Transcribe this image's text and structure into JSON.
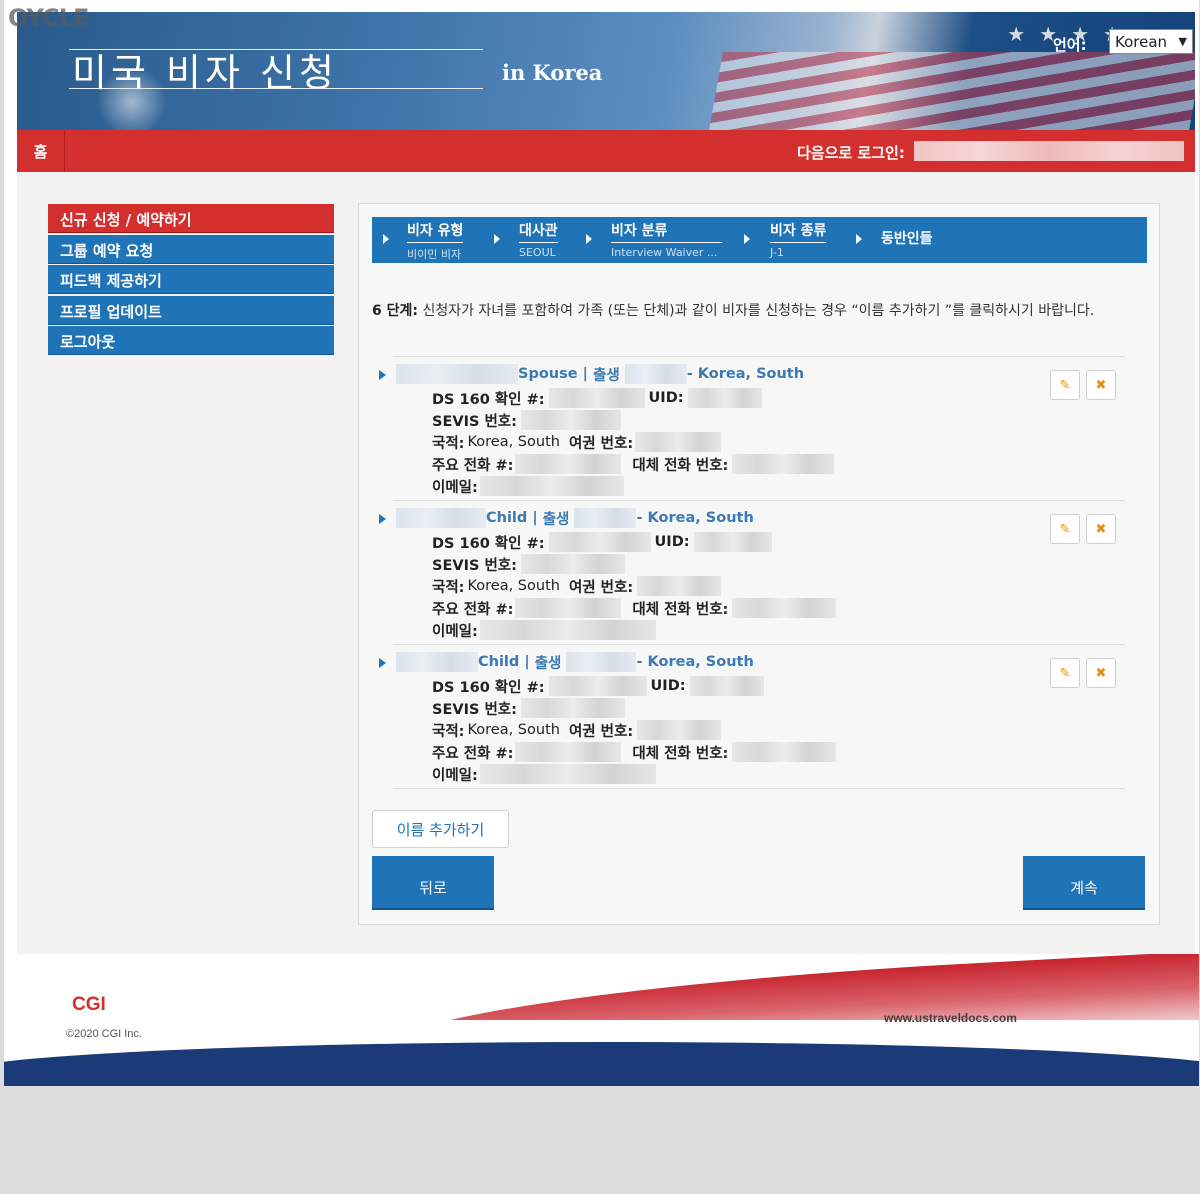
{
  "watermark": "OYCLE",
  "header": {
    "title": "미국 비자 신청",
    "subtitle": "in Korea",
    "language_label": "언어:",
    "language_value": "Korean"
  },
  "nav": {
    "home": "홈",
    "logged_in_label": "다음으로 로그인:"
  },
  "sidebar": {
    "items": [
      {
        "label": "신규 신청 / 예약하기",
        "active": true
      },
      {
        "label": "그룹 예약 요청",
        "active": false
      },
      {
        "label": "피드백 제공하기",
        "active": false
      },
      {
        "label": "프로필 업데이트",
        "active": false
      },
      {
        "label": "로그아웃",
        "active": false
      }
    ]
  },
  "steps": [
    {
      "title": "비자 유형",
      "value": "비이민 비자"
    },
    {
      "title": "대사관",
      "value": "SEOUL"
    },
    {
      "title": "비자 분류",
      "value": "Interview Waiver ..."
    },
    {
      "title": "비자 종류",
      "value": "J-1"
    },
    {
      "title": "동반인들",
      "value": ""
    }
  ],
  "instructions": {
    "step_label": "6 단계:",
    "text": "신청자가 자녀를 포함하여 가족 (또는 단체)과 같이 비자를 신청하는 경우 “이름 추가하기 ”를 클릭하시기 바랍니다."
  },
  "field_labels": {
    "ds160": "DS 160 확인 #:",
    "uid": "UID:",
    "sevis": "SEVIS 번호:",
    "nationality": "국적:",
    "passport": "여권 번호:",
    "primary_phone": "주요 전화 #:",
    "alt_phone": "대체 전화 번호:",
    "email": "이메일:"
  },
  "applicants": [
    {
      "relation": "Spouse |",
      "born_label": "출생",
      "country": "- Korea, South",
      "nationality": "Korea, South"
    },
    {
      "relation": "Child |",
      "born_label": "출생",
      "country": "- Korea, South",
      "nationality": "Korea, South"
    },
    {
      "relation": "Child |",
      "born_label": "출생",
      "country": "- Korea, South",
      "nationality": "Korea, South"
    }
  ],
  "buttons": {
    "add_name": "이름 추가하기",
    "back": "뒤로",
    "continue": "계속"
  },
  "footer": {
    "company": "CGI",
    "copyright": "©2020 CGI Inc.",
    "url": "www.ustraveldocs.com"
  },
  "colors": {
    "primary_blue": "#1f73b7",
    "nav_red": "#d32f2f",
    "edit_icon": "#e38d12"
  }
}
